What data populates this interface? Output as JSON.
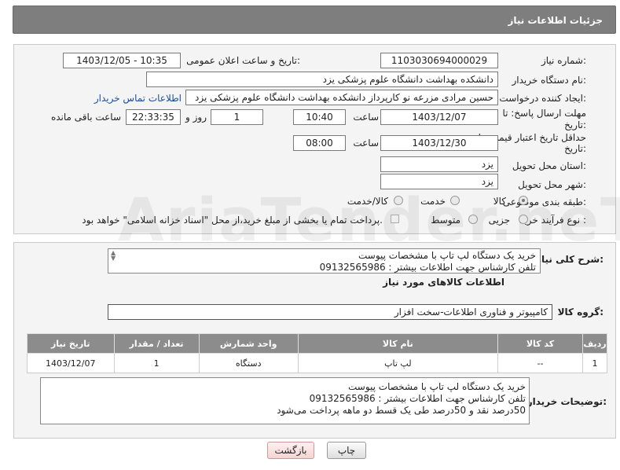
{
  "header": {
    "title": "جزئیات اطلاعات نیاز"
  },
  "watermark": "AriaTender.neT",
  "form": {
    "need_number_label": "شماره نیاز:",
    "need_number": "1103030694000029",
    "announce_label": "تاریخ و ساعت اعلان عمومی:",
    "announce_value": "1403/12/05 - 10:35",
    "buyer_org_label": "نام دستگاه خریدار:",
    "buyer_org": "دانشکده بهداشت دانشگاه علوم پزشکی یزد",
    "requester_label": "ایجاد کننده درخواست:",
    "requester": "حسین مرادی مزرعه نو کارپرداز دانشکده بهداشت دانشگاه علوم پزشکی یزد",
    "contact_link": "اطلاعات تماس خریدار",
    "deadline_label_1": "مهلت ارسال پاسخ: تا",
    "deadline_label_2": "تاریخ:",
    "deadline_date": "1403/12/07",
    "time_label": "ساعت",
    "deadline_time": "10:40",
    "days_value": "1",
    "days_label": "روز و",
    "remaining_time": "22:33:35",
    "remaining_label": "ساعت باقی مانده",
    "validity_label_1": "حداقل تاریخ اعتبار قیمت: تا",
    "validity_label_2": "تاریخ:",
    "validity_date": "1403/12/30",
    "validity_time": "08:00",
    "province_label": "استان محل تحویل:",
    "province": "یزد",
    "city_label": "شهر محل تحویل:",
    "city": "یزد",
    "category_label": "طبقه بندی موضوعی:",
    "category_options": [
      "کالا",
      "خدمت",
      "کالا/خدمت"
    ],
    "category_selected": "کالا",
    "purchase_type_label": "نوع فرآیند خرید :",
    "purchase_options": [
      "جزیی",
      "متوسط"
    ],
    "payment_note": "پرداخت تمام یا بخشی از مبلغ خرید،از محل \"اسناد خزانه اسلامی\" خواهد بود."
  },
  "summary": {
    "label": "شرح کلی نیاز:",
    "lines": [
      "خرید یک دستگاه لپ تاپ با مشخصات پیوست",
      "تلفن کارشناس جهت اطلاعات بیشتر : 09132565986"
    ]
  },
  "goods_title": "اطلاعات کالاهای مورد نیاز",
  "goods_group_label": "گروه کالا:",
  "goods_group": "کامپیوتر و فناوری اطلاعات-سخت افزار",
  "table": {
    "headers": [
      "ردیف",
      "کد کالا",
      "نام کالا",
      "واحد شمارش",
      "تعداد / مقدار",
      "تاریخ نیاز"
    ],
    "rows": [
      [
        "1",
        "--",
        "لپ تاپ",
        "دستگاه",
        "1",
        "1403/12/07"
      ]
    ]
  },
  "buyer_notes": {
    "label": "توضیحات خریدار:",
    "lines": [
      "خرید یک دستگاه لپ تاپ با مشخصات پیوست",
      "تلفن کارشناس جهت اطلاعات بیشتر : 09132565986",
      "50درصد نقد و 50درصد طی یک قسط دو ماهه پرداخت می‌شود"
    ]
  },
  "buttons": {
    "print": "چاپ",
    "back": "بازگشت"
  }
}
